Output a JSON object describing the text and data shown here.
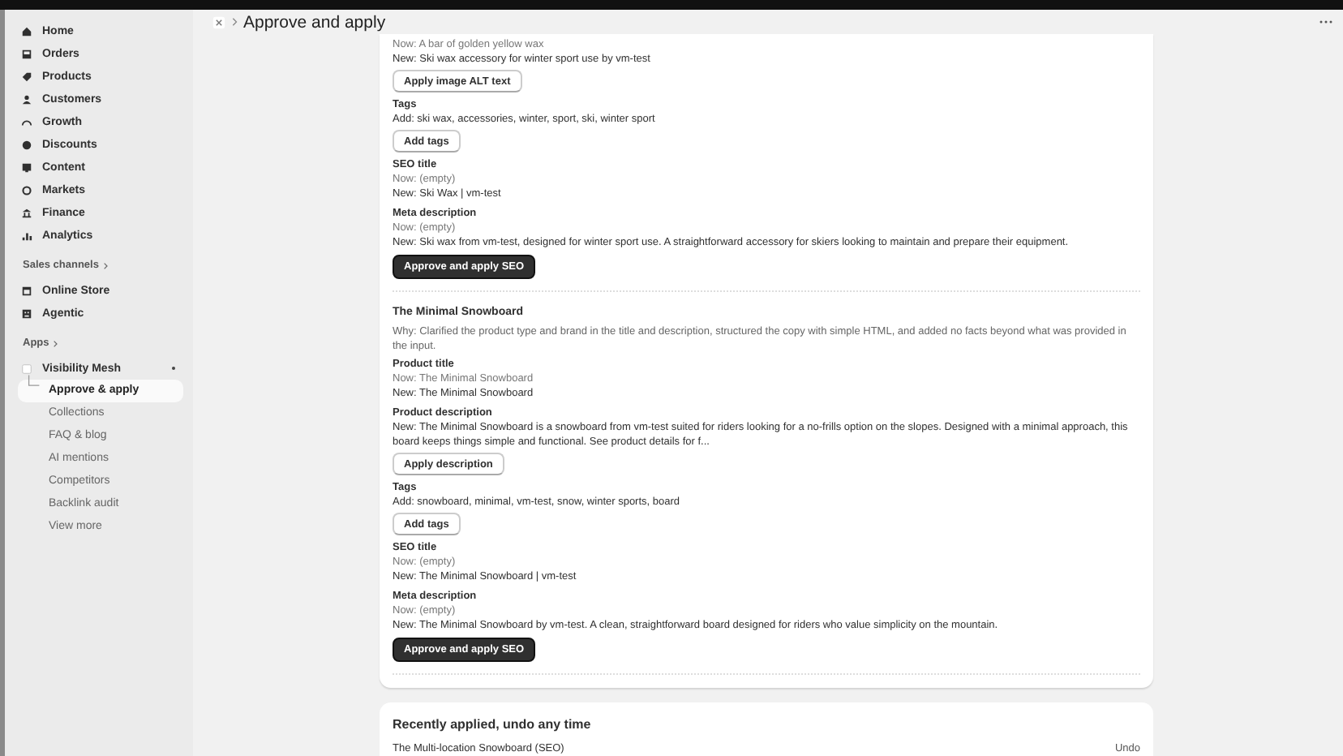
{
  "sidebar": {
    "groups": [
      {
        "items": [
          {
            "label": "Home",
            "selected": false
          },
          {
            "label": "Orders",
            "selected": false
          },
          {
            "label": "Products",
            "selected": false
          },
          {
            "label": "Customers",
            "selected": false
          },
          {
            "label": "Growth",
            "selected": false
          },
          {
            "label": "Discounts",
            "selected": false
          },
          {
            "label": "Content",
            "selected": false
          },
          {
            "label": "Markets",
            "selected": false
          },
          {
            "label": "Finance",
            "selected": false
          },
          {
            "label": "Analytics",
            "selected": false
          }
        ]
      },
      {
        "heading": "Sales channels",
        "items": [
          {
            "label": "Online Store",
            "selected": false
          },
          {
            "label": "Agentic",
            "selected": false
          }
        ]
      },
      {
        "heading": "Apps",
        "items": [
          {
            "label": "Visibility Mesh",
            "selected": false,
            "children": [
              {
                "label": "Approve & apply",
                "selected": true
              },
              {
                "label": "Collections",
                "selected": false
              },
              {
                "label": "FAQ & blog",
                "selected": false
              },
              {
                "label": "AI mentions",
                "selected": false
              },
              {
                "label": "Competitors",
                "selected": false
              },
              {
                "label": "Backlink audit",
                "selected": false
              },
              {
                "label": "View more",
                "selected": false
              }
            ]
          }
        ]
      }
    ]
  },
  "header": {
    "title": "Approve and apply"
  },
  "products": [
    {
      "blocks": [
        {
          "lines": [
            {
              "text": "Now: A bar of golden yellow wax",
              "muted": true
            },
            {
              "text": "New: Ski wax accessory for winter sport use by vm-test",
              "muted": false
            }
          ],
          "button": "Apply image ALT text"
        },
        {
          "label": "Tags",
          "lines": [
            {
              "text": "Add: ski wax, accessories, winter, sport, ski, winter sport",
              "muted": false
            }
          ],
          "button": "Add tags"
        },
        {
          "label": "SEO title",
          "lines": [
            {
              "text": "Now: (empty)",
              "muted": true
            },
            {
              "text": "New: Ski Wax | vm-test",
              "muted": false
            }
          ]
        },
        {
          "label": "Meta description",
          "lines": [
            {
              "text": "Now: (empty)",
              "muted": true
            },
            {
              "text": "New: Ski wax from vm-test, designed for winter sport use. A straightforward accessory for skiers looking to maintain and prepare their equipment.",
              "muted": false
            }
          ]
        }
      ],
      "action": "Approve and apply SEO"
    },
    {
      "title": "The Minimal Snowboard",
      "why": "Why: Clarified the product type and brand in the title and description, structured the copy with simple HTML, and added no facts beyond what was provided in the input.",
      "blocks": [
        {
          "label": "Product title",
          "lines": [
            {
              "text": "Now: The Minimal Snowboard",
              "muted": true
            },
            {
              "text": "New: The Minimal Snowboard",
              "muted": false
            }
          ]
        },
        {
          "label": "Product description",
          "lines": [
            {
              "text": "New: The Minimal Snowboard is a snowboard from vm-test suited for riders looking for a no-frills option on the slopes. Designed with a minimal approach, this board keeps things simple and functional. See product details for f...",
              "muted": false
            }
          ],
          "button": "Apply description"
        },
        {
          "label": "Tags",
          "lines": [
            {
              "text": "Add: snowboard, minimal, vm-test, snow, winter sports, board",
              "muted": false
            }
          ],
          "button": "Add tags"
        },
        {
          "label": "SEO title",
          "lines": [
            {
              "text": "Now: (empty)",
              "muted": true
            },
            {
              "text": "New: The Minimal Snowboard | vm-test",
              "muted": false
            }
          ]
        },
        {
          "label": "Meta description",
          "lines": [
            {
              "text": "Now: (empty)",
              "muted": true
            },
            {
              "text": "New: The Minimal Snowboard by vm-test. A clean, straightforward board designed for riders who value simplicity on the mountain.",
              "muted": false
            }
          ]
        }
      ],
      "action": "Approve and apply SEO"
    }
  ],
  "recent": {
    "title": "Recently applied, undo any time",
    "rows": [
      {
        "name": "The Multi-location Snowboard (SEO)",
        "action": "Undo"
      }
    ]
  }
}
